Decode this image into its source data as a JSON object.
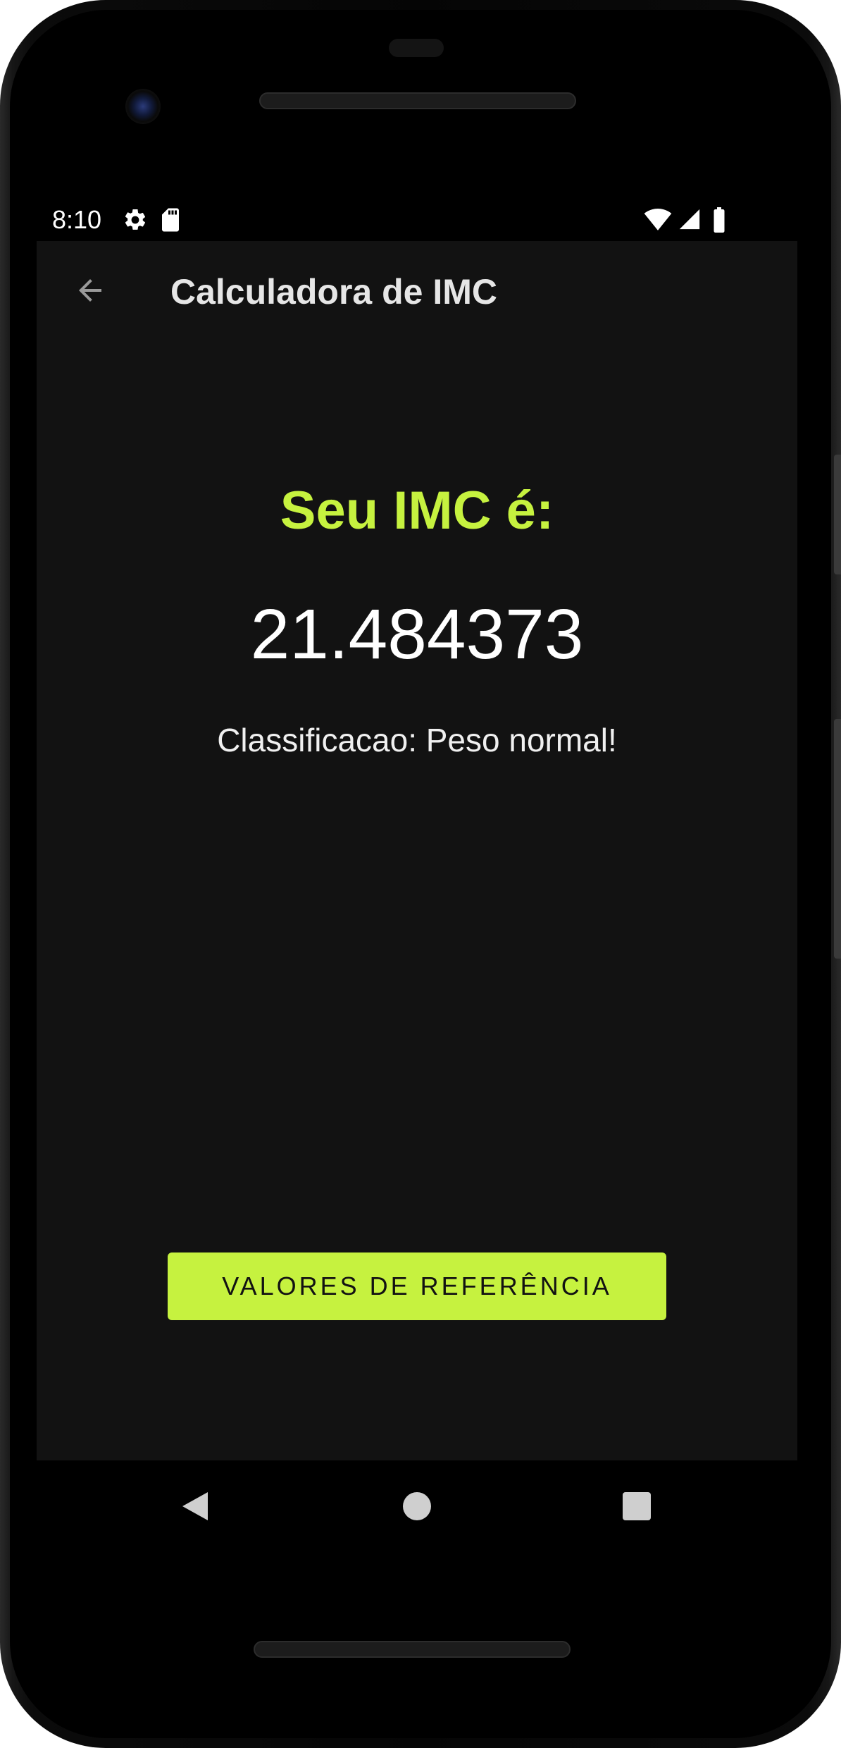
{
  "status_bar": {
    "time": "8:10"
  },
  "app_bar": {
    "title": "Calculadora de IMC"
  },
  "result": {
    "heading": "Seu IMC é:",
    "value": "21.484373",
    "classification": "Classificacao: Peso normal!"
  },
  "actions": {
    "reference_button_label": "VALORES DE REFERÊNCIA"
  },
  "colors": {
    "accent": "#c6f23f",
    "background": "#121212",
    "text_primary": "#ffffff"
  },
  "icons": {
    "status": [
      "gear-icon",
      "sd-card-icon",
      "wifi-icon",
      "cell-signal-icon",
      "battery-icon"
    ],
    "app_bar": "arrow-back-icon",
    "navigation": [
      "nav-back-icon",
      "nav-home-icon",
      "nav-recents-icon"
    ]
  }
}
